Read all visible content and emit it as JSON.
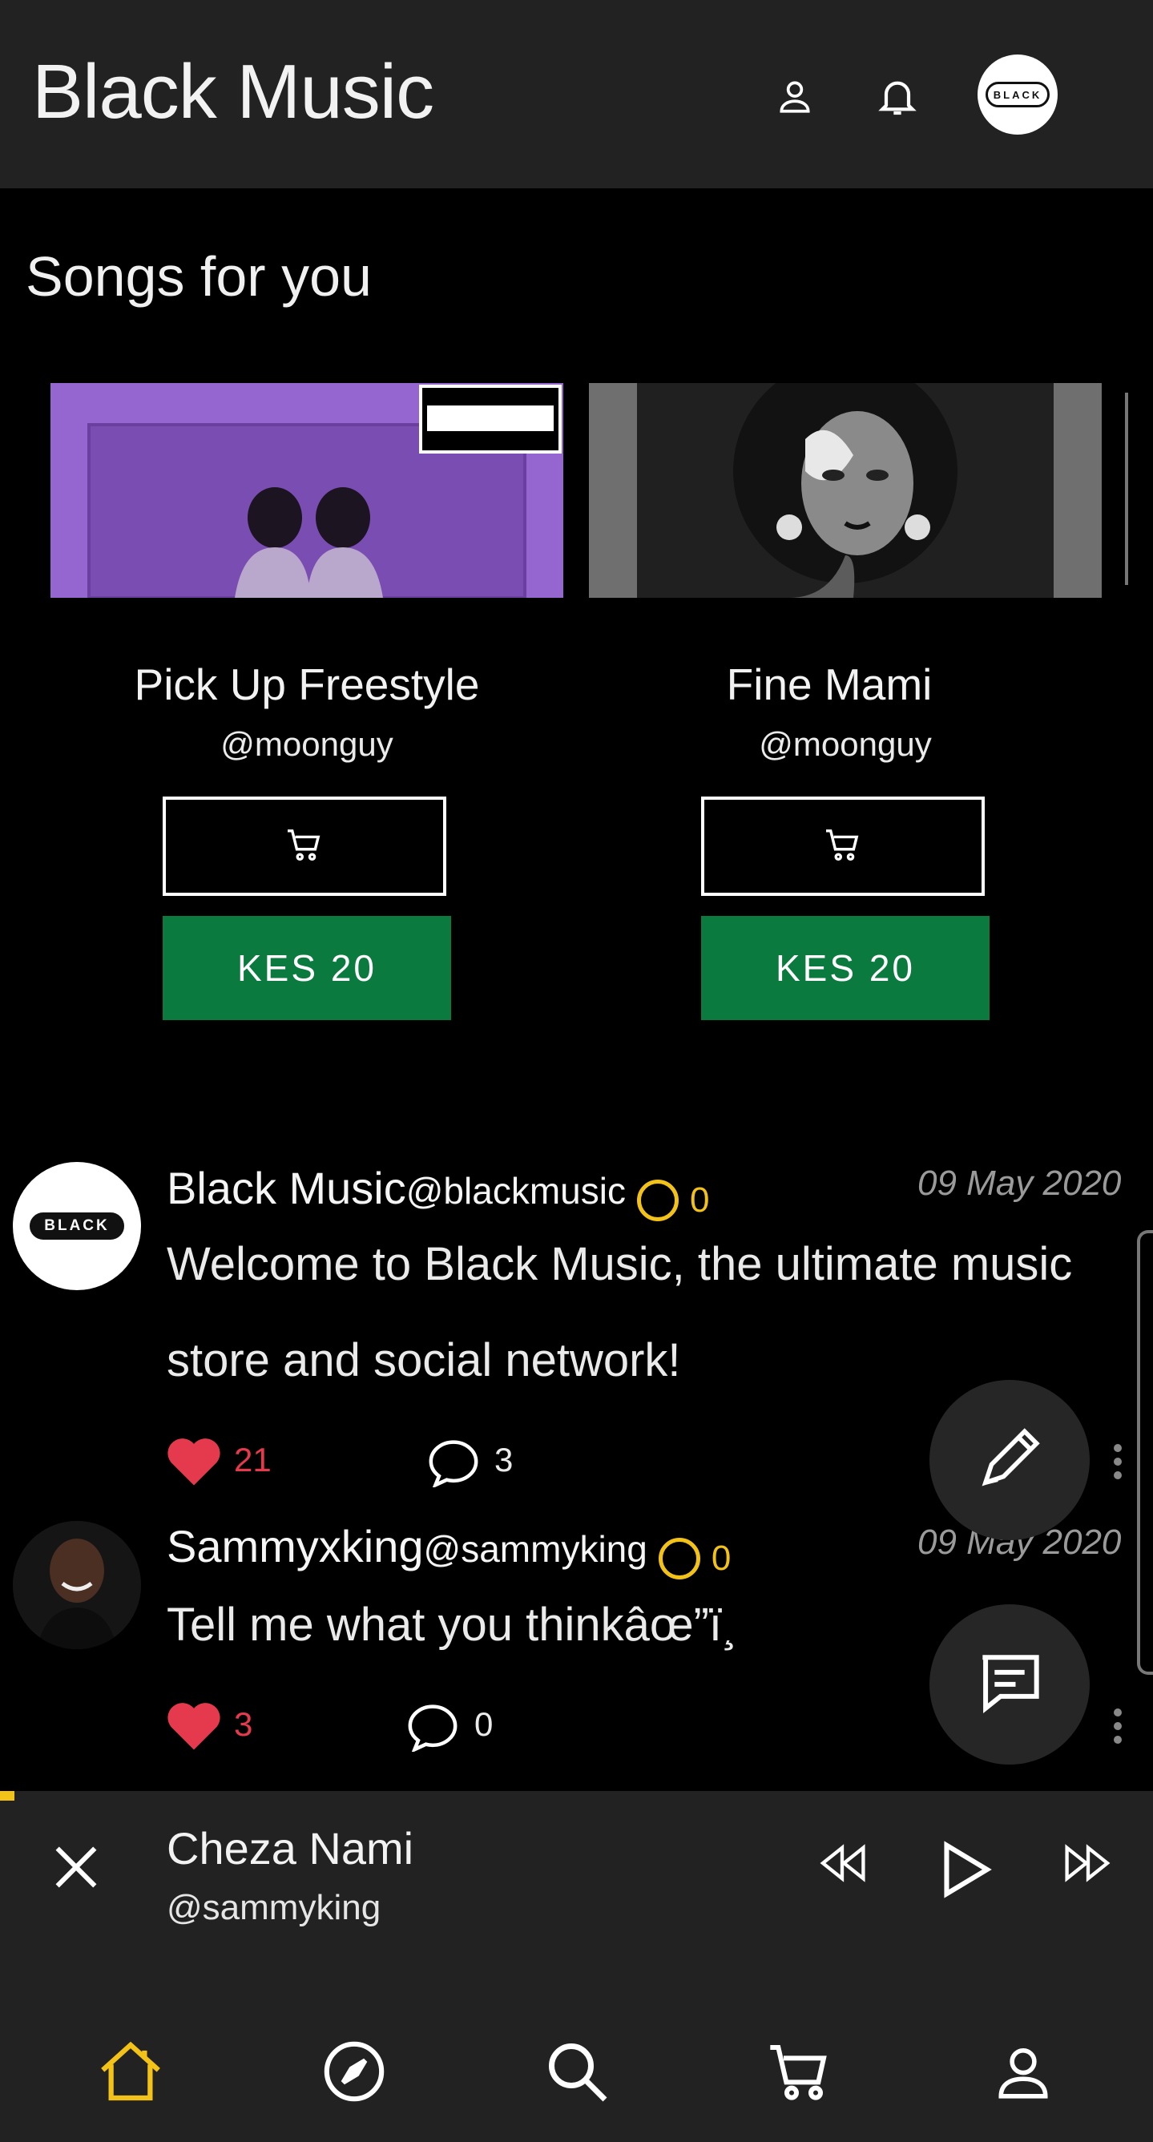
{
  "header": {
    "title": "Black Music",
    "profile_icon": "user-icon",
    "notifications_icon": "bell-icon",
    "avatar_logo_text": "BLACK"
  },
  "songs_section": {
    "title": "Songs for you",
    "songs": [
      {
        "title": "Pick Up Freestyle",
        "artist": "@moonguy",
        "cart_icon": "cart-icon",
        "price": "KES 20"
      },
      {
        "title": "Fine Mami",
        "artist": "@moonguy",
        "cart_icon": "cart-icon",
        "price": "KES 20"
      }
    ]
  },
  "posts": [
    {
      "name": "Black Music",
      "handle": "@blackmusic",
      "coins": "0",
      "date": "09 May 2020",
      "text_line1": "Welcome to Black Music, the ultimate music",
      "text_line2": "store and social network!",
      "likes": "21",
      "comments": "3",
      "avatar_logo_text": "BLACK"
    },
    {
      "name": "Sammyxking",
      "handle": "@sammyking",
      "coins": "0",
      "date": "09 May 2020",
      "text_line1": "Tell me what you thinkâœ”ï¸",
      "likes": "3",
      "comments": "0"
    }
  ],
  "fabs": {
    "compose_icon": "pencil-icon",
    "chat_icon": "message-icon"
  },
  "player": {
    "title": "Cheza Nami",
    "artist": "@sammyking"
  },
  "bottom_nav": {
    "items": [
      "home-icon",
      "compass-icon",
      "search-icon",
      "cart-icon",
      "user-icon"
    ],
    "active": "home-icon"
  },
  "colors": {
    "accent": "#f2c218",
    "price_button": "#0b7a3f",
    "like": "#e53a4d",
    "bar": "#222222"
  }
}
